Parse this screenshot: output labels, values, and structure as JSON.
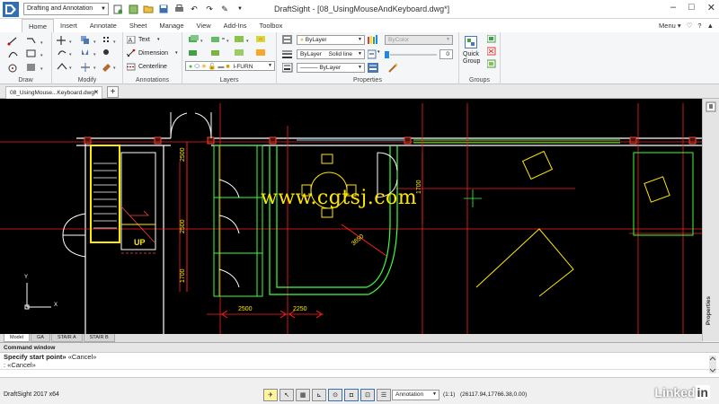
{
  "colors": {
    "canvas_bg": "#000000",
    "wall": "#ffffff",
    "stair_highlight": "#ffea00",
    "dimension": "#ff2020",
    "furniture": "#ffe600",
    "room": "#3cff3c",
    "watermark": "#ffe600"
  },
  "titlebar": {
    "workspace": "Drafting and Annotation",
    "window_title": "DraftSight - [08_UsingMouseAndKeyboard.dwg*]",
    "controls": [
      "–",
      "□",
      "✕"
    ]
  },
  "tabs": [
    "Home",
    "Insert",
    "Annotate",
    "Sheet",
    "Manage",
    "View",
    "Add-Ins",
    "Toolbox"
  ],
  "tab_right": {
    "menu": "Menu ▾",
    "icons": [
      "heart-icon",
      "help-icon"
    ]
  },
  "ribbon": {
    "draw": {
      "title": "Draw"
    },
    "modify": {
      "title": "Modify"
    },
    "annotations": {
      "title": "Annotations",
      "text": "Text",
      "dimension": "Dimension",
      "centerline": "Centerline"
    },
    "layers": {
      "title": "Layers",
      "current_layer": "I-FURN"
    },
    "properties": {
      "title": "Properties",
      "color": "ByLayer",
      "linetype_layer": "ByLayer",
      "linetype": "Solid line",
      "lineweight": "ByLayer",
      "bycolor": "ByColor",
      "transparency": "0"
    },
    "groups": {
      "title": "Groups",
      "quick_group_line1": "Quick",
      "quick_group_line2": "Group"
    }
  },
  "document": {
    "tab_label": "08_UsingMouse...Keyboard.dwg*",
    "add": "+"
  },
  "drawing": {
    "dims": [
      "2500",
      "2500",
      "1700",
      "2500",
      "2250",
      "1700",
      "3650"
    ],
    "stair_label": "UP",
    "watermark": "www.cgtsj.com",
    "ucs_x": "X",
    "ucs_y": "Y"
  },
  "side_panel": {
    "label": "Properties"
  },
  "layout_tabs": [
    "Model",
    "GA",
    "STAIR A",
    "STAIR B"
  ],
  "command": {
    "header": "Command window",
    "line1_bold": "Specify start point»",
    "line1_rest": " «Cancel»",
    "line2": ": «Cancel»"
  },
  "statusbar": {
    "app": "DraftSight 2017 x64",
    "annotation": "Annotation",
    "scale": "(1:1)",
    "coords": "(26117.94,17766.38,0.00)",
    "brand": "Linked",
    "brand_in": "in"
  }
}
